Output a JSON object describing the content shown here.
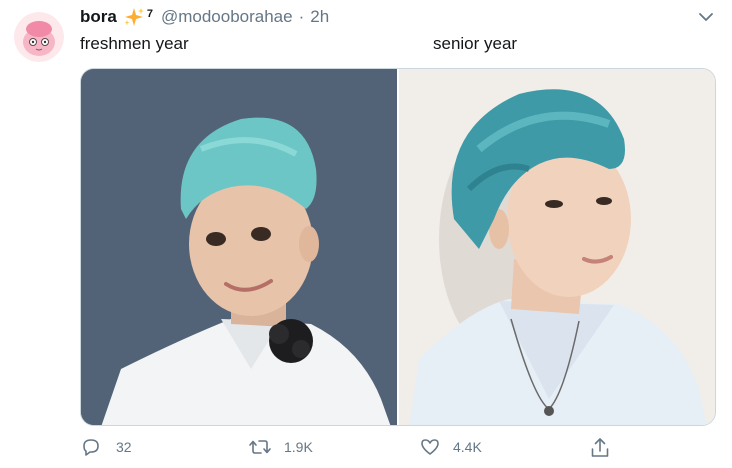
{
  "tweet": {
    "name": "bora",
    "badge_number": "7",
    "handle": "@modooborahae",
    "separator": "·",
    "time": "2h",
    "text_left": "freshmen year",
    "text_right": "senior year"
  },
  "media": {
    "photos": [
      {
        "label": "freshmen year photo",
        "background": "#55667a"
      },
      {
        "label": "senior year photo",
        "background": "#f1eeea"
      }
    ],
    "hair_color": "#5fb8bd"
  },
  "actions": {
    "reply_count": "32",
    "retweet_count": "1.9K",
    "like_count": "4.4K"
  },
  "icons": {
    "reply": "reply-icon",
    "retweet": "retweet-icon",
    "like": "like-icon",
    "share": "share-icon",
    "caret": "chevron-down-icon",
    "sparkle": "sparkles-emoji-icon"
  },
  "colors": {
    "text": "#14171a",
    "muted": "#657786",
    "border": "#ccd6dd",
    "sparkle": "#ffac33"
  }
}
